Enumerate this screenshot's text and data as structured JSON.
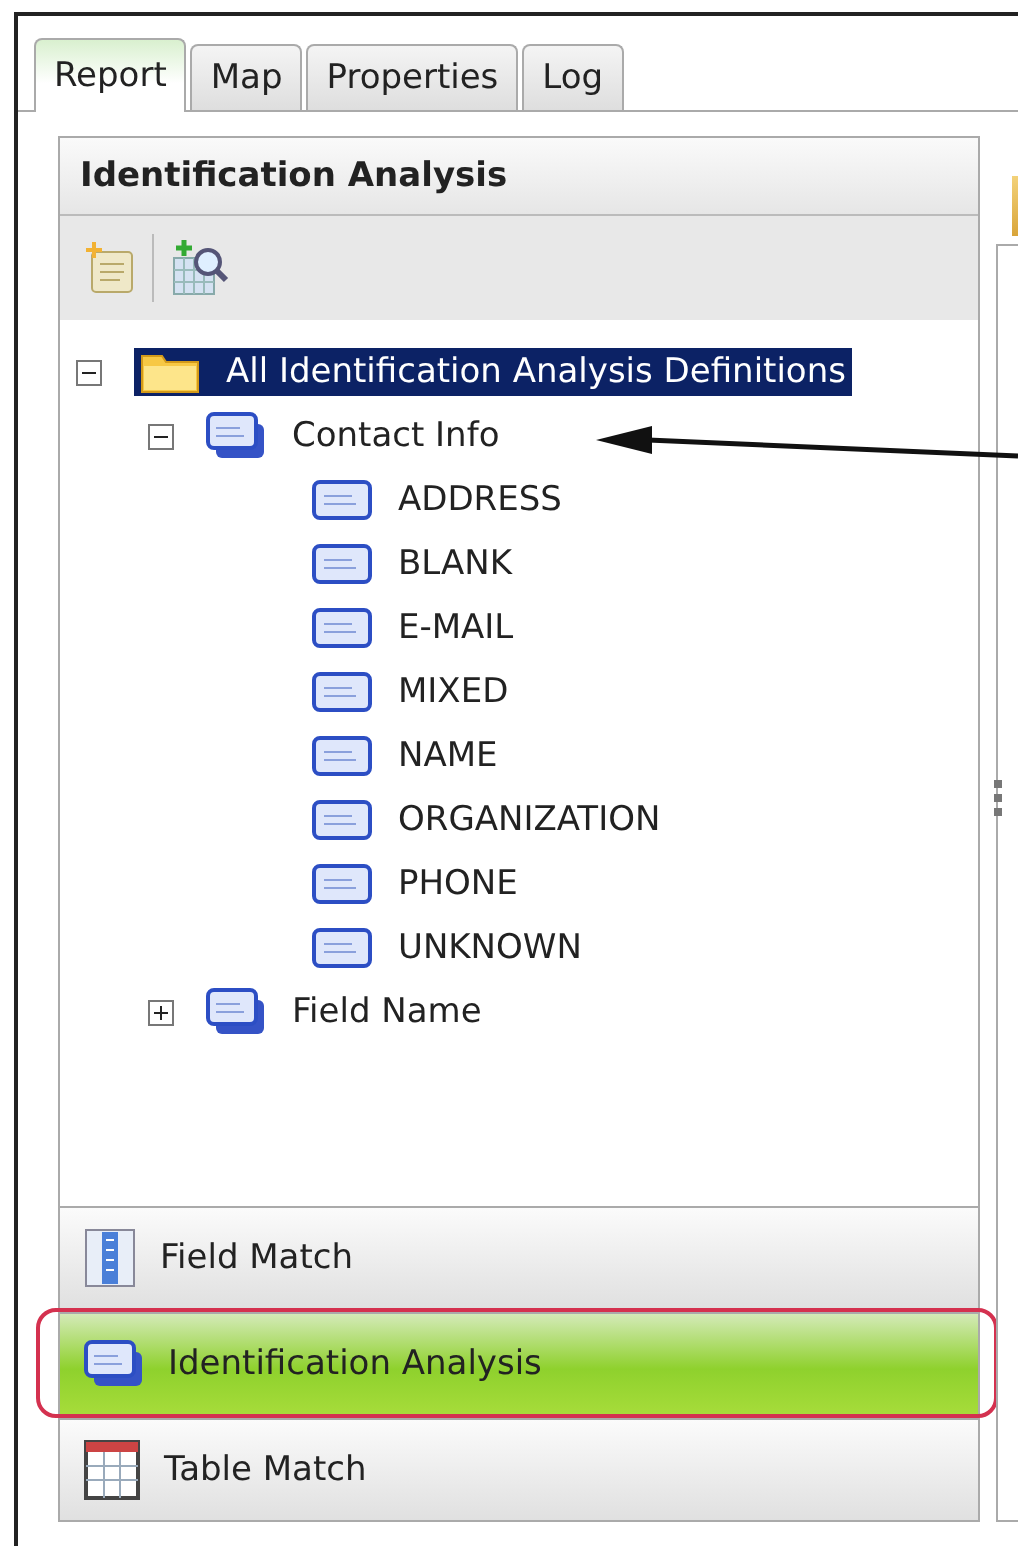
{
  "tabs": [
    {
      "label": "Report",
      "selected": true
    },
    {
      "label": "Map",
      "selected": false
    },
    {
      "label": "Properties",
      "selected": false
    },
    {
      "label": "Log",
      "selected": false
    }
  ],
  "panel": {
    "title": "Identification Analysis"
  },
  "tree": [
    {
      "label": "All Identification Analysis Definitions",
      "kind": "folder",
      "selected": true,
      "expanded": true,
      "children": [
        {
          "label": "Contact Info",
          "kind": "group",
          "selected": false,
          "expanded": true,
          "children": [
            {
              "label": "ADDRESS",
              "kind": "leaf",
              "selected": false
            },
            {
              "label": "BLANK",
              "kind": "leaf",
              "selected": false
            },
            {
              "label": "E-MAIL",
              "kind": "leaf",
              "selected": false
            },
            {
              "label": "MIXED",
              "kind": "leaf",
              "selected": false
            },
            {
              "label": "NAME",
              "kind": "leaf",
              "selected": false
            },
            {
              "label": "ORGANIZATION",
              "kind": "leaf",
              "selected": false
            },
            {
              "label": "PHONE",
              "kind": "leaf",
              "selected": false
            },
            {
              "label": "UNKNOWN",
              "kind": "leaf",
              "selected": false
            }
          ]
        },
        {
          "label": "Field Name",
          "kind": "group",
          "selected": false,
          "expanded": false
        }
      ]
    }
  ],
  "nav": [
    {
      "label": "Field Match",
      "kind": "columns",
      "selected": false
    },
    {
      "label": "Identification Analysis",
      "kind": "cards",
      "selected": true
    },
    {
      "label": "Table Match",
      "kind": "table",
      "selected": false
    }
  ]
}
